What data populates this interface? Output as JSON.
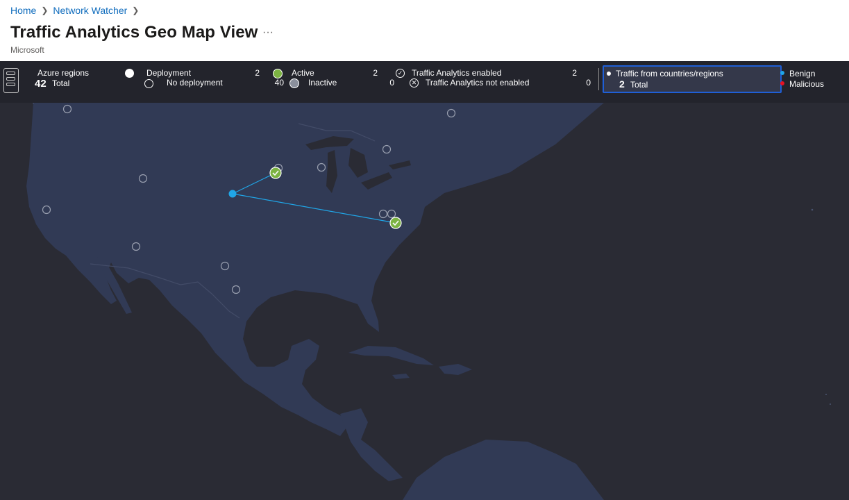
{
  "breadcrumb": [
    {
      "label": "Home"
    },
    {
      "label": "Network Watcher"
    }
  ],
  "page": {
    "title": "Traffic Analytics Geo Map View",
    "more_label": "···",
    "subtitle": "Microsoft"
  },
  "legend": {
    "azure_regions_label": "Azure regions",
    "azure_regions_total": "42",
    "total_label": "Total",
    "deployment_label": "Deployment",
    "deployment_count": "2",
    "no_deployment_label": "No deployment",
    "no_deployment_count": "40",
    "active_label": "Active",
    "active_count": "2",
    "inactive_label": "Inactive",
    "inactive_count": "0",
    "ta_enabled_label": "Traffic Analytics enabled",
    "ta_enabled_count": "2",
    "ta_not_enabled_label": "Traffic Analytics not enabled",
    "ta_not_enabled_count": "0",
    "traffic_label": "Traffic from countries/regions",
    "traffic_total": "2",
    "benign_label": "Benign",
    "malicious_label": "Malicious"
  },
  "colors": {
    "land": "#313a55",
    "water": "#2a2b34",
    "legend_bg": "#23242c",
    "active_green": "#7cb342",
    "benign_blue": "#20a6e8",
    "malicious_red": "#e81123",
    "accent_border": "#1f5fd6",
    "link": "#0f6cbd"
  }
}
